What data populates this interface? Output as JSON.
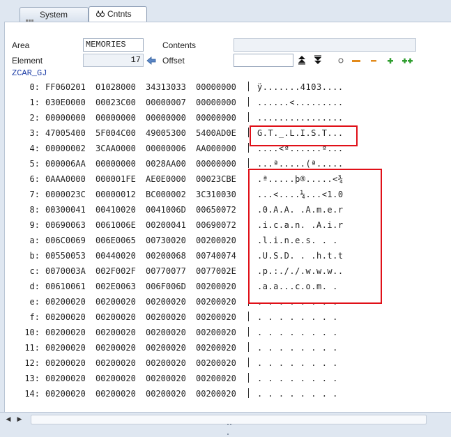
{
  "tabs": [
    {
      "label": "System Areas",
      "active": false
    },
    {
      "label": "Cntnts",
      "active": true
    }
  ],
  "fields": {
    "area_label": "Area",
    "area_value": "MEMORIES",
    "element_label": "Element",
    "element_value": "17",
    "contents_label": "Contents",
    "contents_value": "",
    "offset_label": "Offset",
    "offset_value": ""
  },
  "variable_name": "ZCAR_GJ",
  "dump_rows": [
    {
      "index": "0:",
      "hex": [
        "FF060201",
        "01028000",
        "34313033",
        "00000000"
      ],
      "ascii": "ÿ.......4103...."
    },
    {
      "index": "1:",
      "hex": [
        "030E0000",
        "00023C00",
        "00000007",
        "00000000"
      ],
      "ascii": "......<........."
    },
    {
      "index": "2:",
      "hex": [
        "00000000",
        "00000000",
        "00000000",
        "00000000"
      ],
      "ascii": "................"
    },
    {
      "index": "3:",
      "hex": [
        "47005400",
        "5F004C00",
        "49005300",
        "5400AD0E"
      ],
      "ascii": "G.T._.L.I.S.T..."
    },
    {
      "index": "4:",
      "hex": [
        "00000002",
        "3CAA0000",
        "00000006",
        "AA000000"
      ],
      "ascii": "....<ª......ª..."
    },
    {
      "index": "5:",
      "hex": [
        "000006AA",
        "00000000",
        "0028AA00",
        "00000000"
      ],
      "ascii": "...ª.....(ª....."
    },
    {
      "index": "6:",
      "hex": [
        "0AAA0000",
        "000001FE",
        "AE0E0000",
        "00023CBE"
      ],
      "ascii": ".ª.....þ®.....<¾"
    },
    {
      "index": "7:",
      "hex": [
        "0000023C",
        "00000012",
        "BC000002",
        "3C310030"
      ],
      "ascii": "...<....¼...<1.0"
    },
    {
      "index": "8:",
      "hex": [
        "00300041",
        "00410020",
        "0041006D",
        "00650072"
      ],
      "ascii": ".0.A.A. .A.m.e.r"
    },
    {
      "index": "9:",
      "hex": [
        "00690063",
        "0061006E",
        "00200041",
        "00690072"
      ],
      "ascii": ".i.c.a.n. .A.i.r"
    },
    {
      "index": "a:",
      "hex": [
        "006C0069",
        "006E0065",
        "00730020",
        "00200020"
      ],
      "ascii": ".l.i.n.e.s. . . "
    },
    {
      "index": "b:",
      "hex": [
        "00550053",
        "00440020",
        "00200068",
        "00740074"
      ],
      "ascii": ".U.S.D. . .h.t.t"
    },
    {
      "index": "c:",
      "hex": [
        "0070003A",
        "002F002F",
        "00770077",
        "0077002E"
      ],
      "ascii": ".p.:././.w.w.w.."
    },
    {
      "index": "d:",
      "hex": [
        "00610061",
        "002E0063",
        "006F006D",
        "00200020"
      ],
      "ascii": ".a.a...c.o.m. . "
    },
    {
      "index": "e:",
      "hex": [
        "00200020",
        "00200020",
        "00200020",
        "00200020"
      ],
      "ascii": ". . . . . . . . "
    },
    {
      "index": "f:",
      "hex": [
        "00200020",
        "00200020",
        "00200020",
        "00200020"
      ],
      "ascii": ". . . . . . . . "
    },
    {
      "index": "10:",
      "hex": [
        "00200020",
        "00200020",
        "00200020",
        "00200020"
      ],
      "ascii": ". . . . . . . . "
    },
    {
      "index": "11:",
      "hex": [
        "00200020",
        "00200020",
        "00200020",
        "00200020"
      ],
      "ascii": ". . . . . . . . "
    },
    {
      "index": "12:",
      "hex": [
        "00200020",
        "00200020",
        "00200020",
        "00200020"
      ],
      "ascii": ". . . . . . . . "
    },
    {
      "index": "13:",
      "hex": [
        "00200020",
        "00200020",
        "00200020",
        "00200020"
      ],
      "ascii": ". . . . . . . . "
    },
    {
      "index": "14:",
      "hex": [
        "00200020",
        "00200020",
        "00200020",
        "00200020"
      ],
      "ascii": ". . . . . . . . "
    }
  ],
  "colors": {
    "highlight": "#e01018",
    "variable_name": "#1f3fa8",
    "background": "#dfe7f1"
  },
  "icons": {
    "area_info": "info-arrow-icon",
    "first_page": "first-page-icon",
    "last_page": "last-page-icon",
    "display_mode": "circle-icon",
    "collapse": "minus-icon",
    "zoom_out": "small-minus-icon",
    "zoom_in": "plus-icon",
    "expand_all": "double-plus-icon"
  }
}
